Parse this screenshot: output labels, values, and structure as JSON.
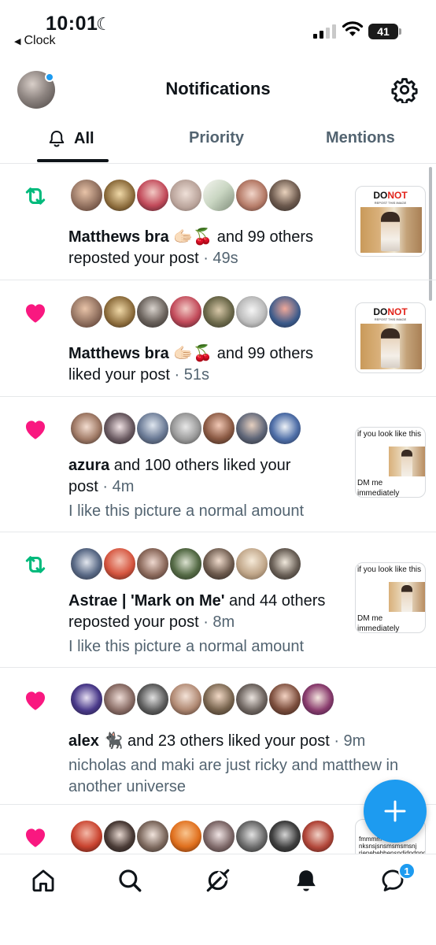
{
  "status_bar": {
    "time": "10:01",
    "back_app": "Clock",
    "battery": "41"
  },
  "header": {
    "title": "Notifications"
  },
  "tabs": [
    {
      "label": "All",
      "active": true
    },
    {
      "label": "Priority",
      "active": false
    },
    {
      "label": "Mentions",
      "active": false
    }
  ],
  "notifications": [
    {
      "type": "repost",
      "name": "Matthews bra 🫱🏻🍒",
      "rest": " and 99 others",
      "action": "reposted your post",
      "time": "· 49s",
      "quote": "",
      "thumb_title_a": "DO",
      "thumb_title_b": "NOT",
      "thumb_sub": "REPOST THIS IMAGE"
    },
    {
      "type": "like",
      "name": "Matthews bra 🫱🏻🍒",
      "rest": " and 99 others",
      "action": "liked your post",
      "time": "· 51s",
      "quote": "",
      "thumb_title_a": "DO",
      "thumb_title_b": "NOT",
      "thumb_sub": "REPOST THIS IMAGE"
    },
    {
      "type": "like",
      "name": "azura",
      "rest": " and 100 others liked your",
      "action": "post",
      "time": "· 4m",
      "quote": "I like this picture a normal amount",
      "thumb_top": "if you look like this",
      "thumb_bottom": "DM me immediately"
    },
    {
      "type": "repost",
      "name": "Astrae | 'Mark on Me'",
      "rest": " and 44 others",
      "action": "reposted your post",
      "time": "· 8m",
      "quote": "I like this picture a normal amount",
      "thumb_top": "if you look like this",
      "thumb_bottom": "DM me immediately"
    },
    {
      "type": "like",
      "name": "alex 🐈‍⬛",
      "rest": " and 23 others liked your post",
      "action": "",
      "time": "· 9m",
      "quote": "nicholas and maki are just ricky and matthew in another universe"
    },
    {
      "type": "like",
      "name": "",
      "rest": "",
      "action": "",
      "time": "",
      "quote": "",
      "thumb_text": "fmmmm nksnsjsnsmsmsmsnj rjenebebbensndjdndnnd"
    }
  ],
  "bottom_nav": {
    "messages_badge": "1"
  },
  "colors": {
    "accent": "#1d9bf0",
    "like": "#f91880",
    "repost": "#00ba7c",
    "text": "#0f1419",
    "secondary": "#536471"
  }
}
